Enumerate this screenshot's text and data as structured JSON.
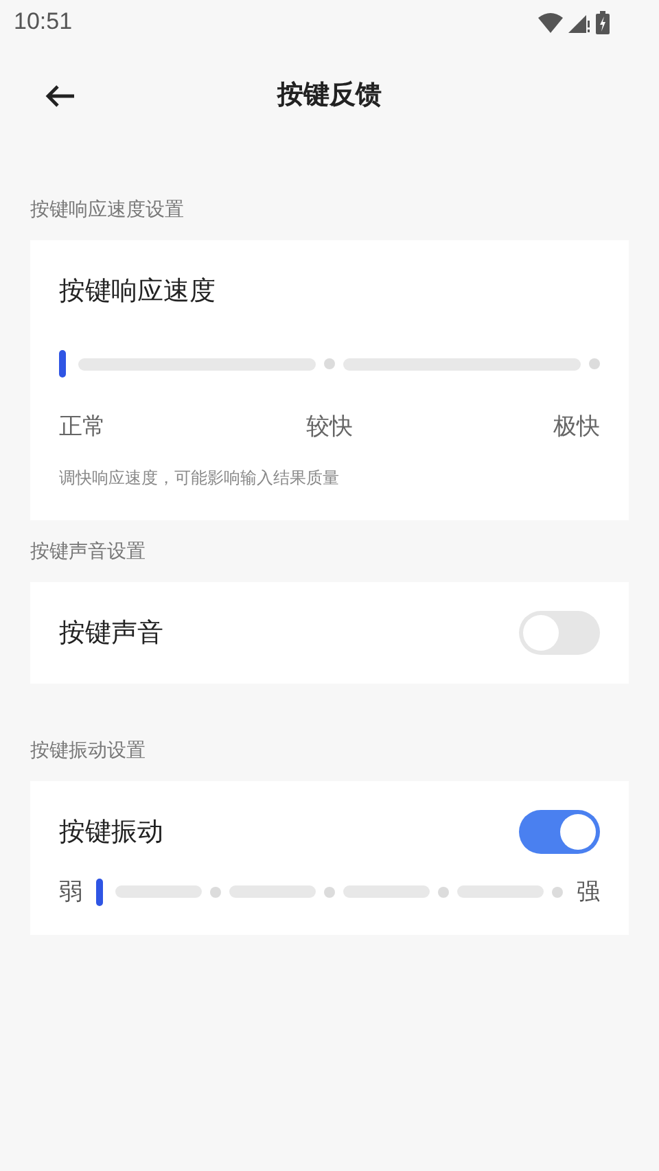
{
  "status_bar": {
    "time": "10:51"
  },
  "header": {
    "title": "按键反馈"
  },
  "sections": [
    {
      "label": "按键响应速度设置",
      "card": {
        "kind": "stepper",
        "title": "按键响应速度",
        "level": 0,
        "stops": [
          "正常",
          "较快",
          "极快"
        ],
        "hint": "调快响应速度，可能影响输入结果质量"
      }
    },
    {
      "label": "按键声音设置",
      "card": {
        "kind": "toggle",
        "title": "按键声音",
        "on": false
      }
    },
    {
      "label": "按键振动设置",
      "card": {
        "kind": "toggle_slider",
        "title": "按键振动",
        "on": true,
        "level": 0,
        "min_label": "弱",
        "max_label": "强"
      }
    }
  ]
}
